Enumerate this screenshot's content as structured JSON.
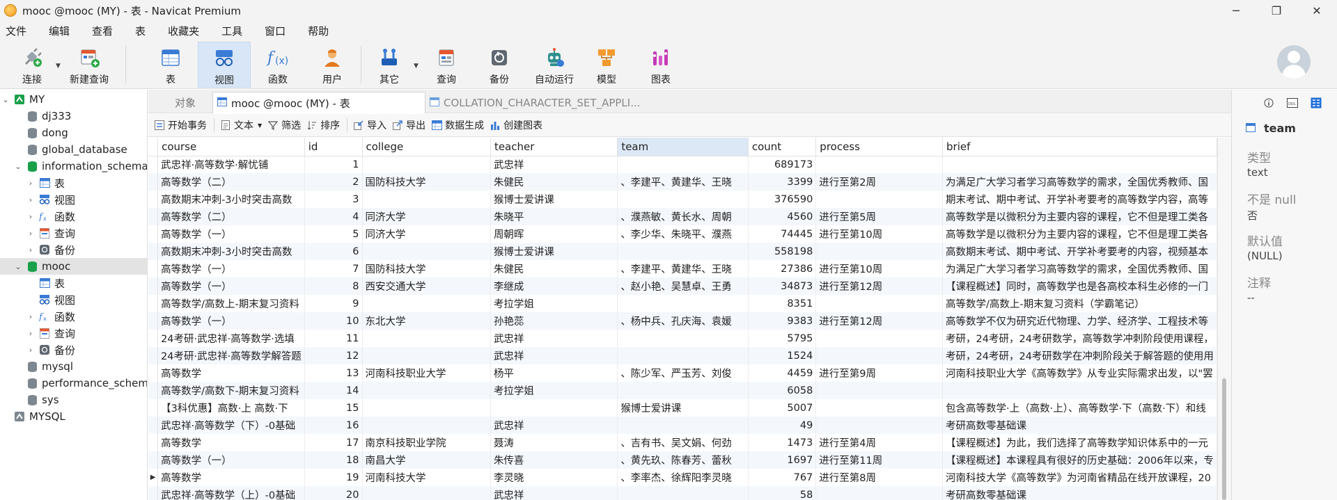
{
  "window": {
    "title": "mooc @mooc (MY) - 表 - Navicat Premium",
    "controls": [
      "─",
      "❐",
      "✕"
    ]
  },
  "menu": [
    "文件",
    "编辑",
    "查看",
    "表",
    "收藏夹",
    "工具",
    "窗口",
    "帮助"
  ],
  "toolbar": {
    "connect": "连接",
    "new_query": "新建查询",
    "table": "表",
    "view": "视图",
    "function": "函数",
    "user": "用户",
    "other": "其它",
    "query": "查询",
    "backup": "备份",
    "auto_run": "自动运行",
    "model": "模型",
    "chart": "图表"
  },
  "sidebar": {
    "items": [
      {
        "label": "MY"
      },
      {
        "label": "dj333"
      },
      {
        "label": "dong"
      },
      {
        "label": "global_database"
      },
      {
        "label": "information_schema"
      },
      {
        "label": "表"
      },
      {
        "label": "视图"
      },
      {
        "label": "函数"
      },
      {
        "label": "查询"
      },
      {
        "label": "备份"
      },
      {
        "label": "mooc"
      },
      {
        "label": "表"
      },
      {
        "label": "视图"
      },
      {
        "label": "函数"
      },
      {
        "label": "查询"
      },
      {
        "label": "备份"
      },
      {
        "label": "mysql"
      },
      {
        "label": "performance_schema"
      },
      {
        "label": "sys"
      },
      {
        "label": "MYSQL"
      }
    ]
  },
  "tabs": {
    "objects": "对象",
    "active": "mooc @mooc (MY) - 表",
    "other": "COLLATION_CHARACTER_SET_APPLI..."
  },
  "datatool": {
    "begin_tx": "开始事务",
    "text": "文本",
    "filter": "筛选",
    "sort": "排序",
    "import": "导入",
    "export": "导出",
    "gen": "数据生成",
    "create_chart": "创建图表"
  },
  "grid": {
    "columns": [
      "course",
      "id",
      "college",
      "teacher",
      "team",
      "count",
      "process",
      "brief"
    ],
    "rows": [
      {
        "course": "武忠祥·高等数学·解忧铺",
        "id": "1",
        "college": "",
        "teacher": "武忠祥",
        "team": "",
        "count": "689173",
        "process": "",
        "brief": ""
      },
      {
        "course": "高等数学（二）",
        "id": "2",
        "college": "国防科技大学",
        "teacher": "朱健民",
        "team": "、李建平、黄建华、王晓",
        "count": "3399",
        "process": "进行至第2周",
        "brief": "为满足广大学习者学习高等数学的需求，全国优秀教师、国"
      },
      {
        "course": "高数期末冲刺-3小时突击高数",
        "id": "3",
        "college": "",
        "teacher": "猴博士爱讲课",
        "team": "",
        "count": "376590",
        "process": "",
        "brief": "期末考试、期中考试、开学补考要考的高等数学内容，高等"
      },
      {
        "course": "高等数学（二）",
        "id": "4",
        "college": "同济大学",
        "teacher": "朱晓平",
        "team": "、濮燕敏、黄长水、周朝",
        "count": "4560",
        "process": "进行至第5周",
        "brief": "高等数学是以微积分为主要内容的课程，它不但是理工类各"
      },
      {
        "course": "高等数学（一）",
        "id": "5",
        "college": "同济大学",
        "teacher": "周朝晖",
        "team": "、李少华、朱晓平、濮燕",
        "count": "74445",
        "process": "进行至第10周",
        "brief": "高等数学是以微积分为主要内容的课程，它不但是理工类各"
      },
      {
        "course": "高数期末冲刺-3小时突击高数",
        "id": "6",
        "college": "",
        "teacher": "猴博士爱讲课",
        "team": "",
        "count": "558198",
        "process": "",
        "brief": "高数期末考试、期中考试、开学补考要考的内容，视频基本"
      },
      {
        "course": "高等数学（一）",
        "id": "7",
        "college": "国防科技大学",
        "teacher": "朱健民",
        "team": "、李建平、黄建华、王晓",
        "count": "27386",
        "process": "进行至第10周",
        "brief": "为满足广大学习者学习高等数学的需求，全国优秀教师、国"
      },
      {
        "course": "高等数学（一）",
        "id": "8",
        "college": "西安交通大学",
        "teacher": "李继成",
        "team": "、赵小艳、吴慧卓、王勇",
        "count": "34873",
        "process": "进行至第12周",
        "brief": "【课程概述】同时，高等数学也是各高校本科生必修的一门"
      },
      {
        "course": "高等数学/高数上-期末复习资料",
        "id": "9",
        "college": "",
        "teacher": "考拉学姐",
        "team": "",
        "count": "8351",
        "process": "",
        "brief": "高等数学/高数上-期末复习资料（学霸笔记）"
      },
      {
        "course": "高等数学（一）",
        "id": "10",
        "college": "东北大学",
        "teacher": "孙艳蕊",
        "team": "、杨中兵、孔庆海、袁媛",
        "count": "9383",
        "process": "进行至第12周",
        "brief": "高等数学不仅为研究近代物理、力学、经济学、工程技术等"
      },
      {
        "course": "24考研·武忠祥·高等数学·选填",
        "id": "11",
        "college": "",
        "teacher": "武忠祥",
        "team": "",
        "count": "5795",
        "process": "",
        "brief": "考研，24考研，24考研数学，高等数学冲刺阶段使用课程，"
      },
      {
        "course": "24考研·武忠祥·高等数学解答题",
        "id": "12",
        "college": "",
        "teacher": "武忠祥",
        "team": "",
        "count": "1524",
        "process": "",
        "brief": "考研，24考研，24考研数学在冲刺阶段关于解答题的使用用"
      },
      {
        "course": "高等数学",
        "id": "13",
        "college": "河南科技职业大学",
        "teacher": "杨平",
        "team": "、陈少军、严玉芳、刘俊",
        "count": "4459",
        "process": "进行至第9周",
        "brief": "河南科技职业大学《高等数学》从专业实际需求出发，以\"罢"
      },
      {
        "course": "高等数学/高数下-期末复习资料",
        "id": "14",
        "college": "",
        "teacher": "考拉学姐",
        "team": "",
        "count": "6058",
        "process": "",
        "brief": ""
      },
      {
        "course": "【3科优惠】高数·上 高数·下",
        "id": "15",
        "college": "",
        "teacher": "",
        "team": "猴博士爱讲课",
        "count": "5007",
        "process": "",
        "brief": "包含高等数学·上（高数·上）、高等数学·下（高数·下）和线"
      },
      {
        "course": "武忠祥·高等数学（下）-0基础",
        "id": "16",
        "college": "",
        "teacher": "武忠祥",
        "team": "",
        "count": "49",
        "process": "",
        "brief": "考研高数零基础课"
      },
      {
        "course": "高等数学",
        "id": "17",
        "college": "南京科技职业学院",
        "teacher": "聂涛",
        "team": "、吉有书、吴文娟、何劲",
        "count": "1473",
        "process": "进行至第4周",
        "brief": "【课程概述】为此，我们选择了高等数学知识体系中的一元"
      },
      {
        "course": "高等数学（一）",
        "id": "18",
        "college": "南昌大学",
        "teacher": "朱传喜",
        "team": "、黄先玖、陈春芳、蕾秋",
        "count": "1697",
        "process": "进行至第11周",
        "brief": "【课程概述】本课程具有很好的历史基础：2006年以来，专"
      },
      {
        "course": "高等数学",
        "id": "19",
        "college": "河南科技大学",
        "teacher": "李灵晓",
        "team": "、李率杰、徐辉阳李灵晓",
        "count": "767",
        "process": "进行至第8周",
        "brief": "河南科技大学《高等数学》为河南省精品在线开放课程，20"
      },
      {
        "course": "武忠祥·高等数学（上）-0基础",
        "id": "20",
        "college": "",
        "teacher": "武忠祥",
        "team": "",
        "count": "58",
        "process": "",
        "brief": "考研高数零基础课"
      }
    ]
  },
  "panel": {
    "field_name": "team",
    "type_label": "类型",
    "type_value": "text",
    "notnull_label": "不是 null",
    "notnull_value": "否",
    "default_label": "默认值",
    "default_value": "(NULL)",
    "comment_label": "注释",
    "comment_value": "--"
  },
  "colors": {
    "accent_blue": "#1e6fd9",
    "green_db": "#1aa04a",
    "selected_header": "#dce8f6"
  }
}
